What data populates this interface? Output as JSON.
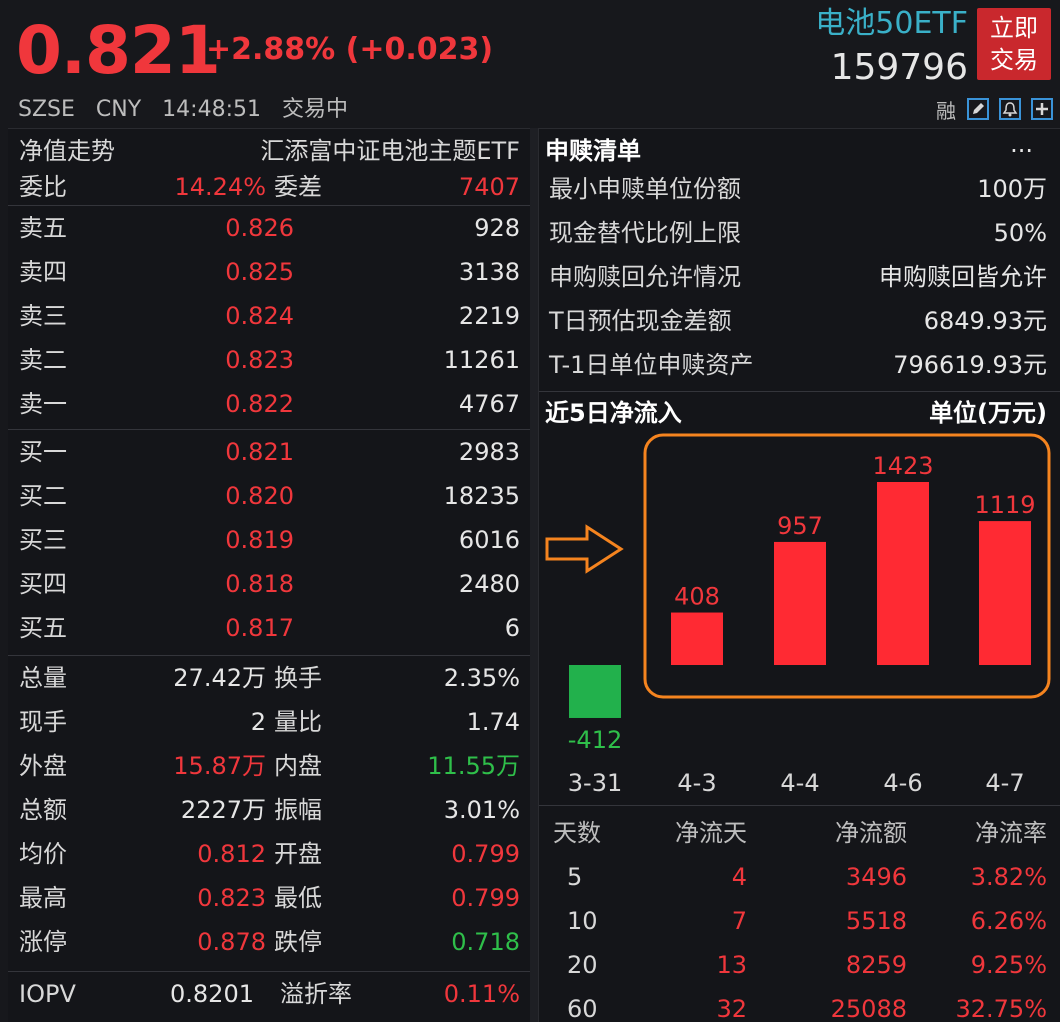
{
  "header": {
    "price": "0.821",
    "change": "+2.88% (+0.023)",
    "exchange": "SZSE",
    "currency": "CNY",
    "time": "14:48:51",
    "status": "交易中",
    "etf_name": "电池50ETF",
    "etf_code": "159796",
    "trade_button": "立即交易",
    "tools": {
      "margin_label": "融"
    }
  },
  "left": {
    "title": "净值走势",
    "fund_name": "汇添富中证电池主题ETF",
    "weibi": {
      "label": "委比",
      "value": "14.24%",
      "label2": "委差",
      "value2": "7407"
    },
    "sell": [
      {
        "label": "卖五",
        "price": "0.826",
        "vol": "928"
      },
      {
        "label": "卖四",
        "price": "0.825",
        "vol": "3138"
      },
      {
        "label": "卖三",
        "price": "0.824",
        "vol": "2219"
      },
      {
        "label": "卖二",
        "price": "0.823",
        "vol": "11261"
      },
      {
        "label": "卖一",
        "price": "0.822",
        "vol": "4767"
      }
    ],
    "buy": [
      {
        "label": "买一",
        "price": "0.821",
        "vol": "2983"
      },
      {
        "label": "买二",
        "price": "0.820",
        "vol": "18235"
      },
      {
        "label": "买三",
        "price": "0.819",
        "vol": "6016"
      },
      {
        "label": "买四",
        "price": "0.818",
        "vol": "2480"
      },
      {
        "label": "买五",
        "price": "0.817",
        "vol": "6"
      }
    ],
    "stats": [
      {
        "k1": "总量",
        "v1": "27.42万",
        "k2": "换手",
        "v2": "2.35%",
        "c1": "white",
        "c2": "white"
      },
      {
        "k1": "现手",
        "v1": "2",
        "k2": "量比",
        "v2": "1.74",
        "c1": "white",
        "c2": "white"
      },
      {
        "k1": "外盘",
        "v1": "15.87万",
        "k2": "内盘",
        "v2": "11.55万",
        "c1": "red",
        "c2": "green"
      },
      {
        "k1": "总额",
        "v1": "2227万",
        "k2": "振幅",
        "v2": "3.01%",
        "c1": "white",
        "c2": "white"
      },
      {
        "k1": "均价",
        "v1": "0.812",
        "k2": "开盘",
        "v2": "0.799",
        "c1": "red",
        "c2": "red"
      },
      {
        "k1": "最高",
        "v1": "0.823",
        "k2": "最低",
        "v2": "0.799",
        "c1": "red",
        "c2": "red"
      },
      {
        "k1": "涨停",
        "v1": "0.878",
        "k2": "跌停",
        "v2": "0.718",
        "c1": "red",
        "c2": "green"
      }
    ],
    "iopv": {
      "k1": "IOPV",
      "v1": "0.8201",
      "k2": "溢折率",
      "v2": "0.11%"
    }
  },
  "right": {
    "title": "申赎清单",
    "more": "···",
    "items": [
      {
        "k": "最小申赎单位份额",
        "v": "100万"
      },
      {
        "k": "现金替代比例上限",
        "v": "50%"
      },
      {
        "k": "申购赎回允许情况",
        "v": "申购赎回皆允许"
      },
      {
        "k": "T日预估现金差额",
        "v": "6849.93元"
      },
      {
        "k": "T-1日单位申赎资产",
        "v": "796619.93元"
      }
    ],
    "flow_title": "近5日净流入",
    "flow_unit": "单位(万元)",
    "flow_table": {
      "headers": [
        "天数",
        "净流天",
        "净流额",
        "净流率"
      ],
      "rows": [
        [
          "5",
          "4",
          "3496",
          "3.82%"
        ],
        [
          "10",
          "7",
          "5518",
          "6.26%"
        ],
        [
          "20",
          "13",
          "8259",
          "9.25%"
        ],
        [
          "60",
          "32",
          "25088",
          "32.75%"
        ]
      ]
    }
  },
  "chart_data": {
    "type": "bar",
    "categories": [
      "3-31",
      "4-3",
      "4-4",
      "4-6",
      "4-7"
    ],
    "values": [
      -412,
      408,
      957,
      1423,
      1119
    ],
    "title": "近5日净流入",
    "unit": "单位(万元)",
    "ylim": [
      -412,
      1423
    ],
    "positive_color": "#ff2a33",
    "negative_color": "#22b14c",
    "highlight_color": "#f5841f"
  }
}
